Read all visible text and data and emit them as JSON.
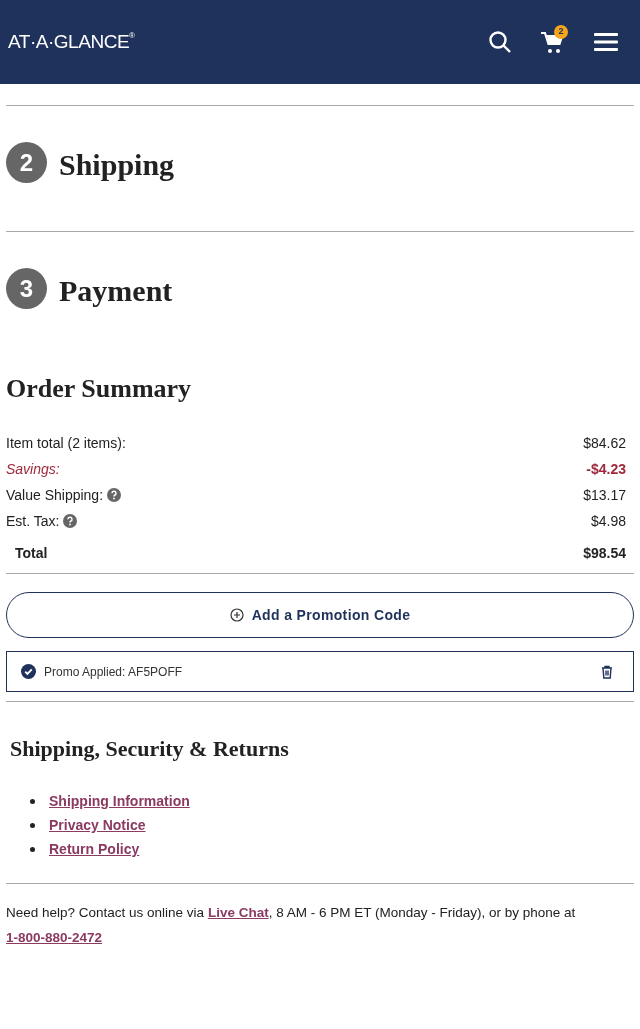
{
  "header": {
    "logo": "AT·A·GLANCE",
    "logo_mark": "®",
    "cart_count": "2"
  },
  "steps": [
    {
      "number": "2",
      "title": "Shipping"
    },
    {
      "number": "3",
      "title": "Payment"
    }
  ],
  "order_summary": {
    "title": "Order Summary",
    "rows": [
      {
        "kind": "normal",
        "label": "Item total (2 items):",
        "value": "$84.62",
        "info": false
      },
      {
        "kind": "savings",
        "label": "Savings:",
        "value": "-$4.23",
        "info": false
      },
      {
        "kind": "normal",
        "label": "Value Shipping:",
        "value": "$13.17",
        "info": true
      },
      {
        "kind": "normal",
        "label": "Est. Tax:",
        "value": "$4.98",
        "info": true
      },
      {
        "kind": "total",
        "label": "Total",
        "value": "$98.54",
        "info": false
      }
    ],
    "promo_button": "Add a Promotion Code",
    "promo_applied": "Promo Applied: AF5POFF"
  },
  "policies": {
    "title": "Shipping, Security & Returns",
    "links": [
      "Shipping Information",
      "Privacy Notice",
      "Return Policy"
    ]
  },
  "help": {
    "before": "Need help? Contact us online via ",
    "chat_link": "Live Chat",
    "middle": ",  8 AM - 6 PM ET (Monday - Friday), or by phone at ",
    "phone_link": "1-800-880-2472"
  }
}
